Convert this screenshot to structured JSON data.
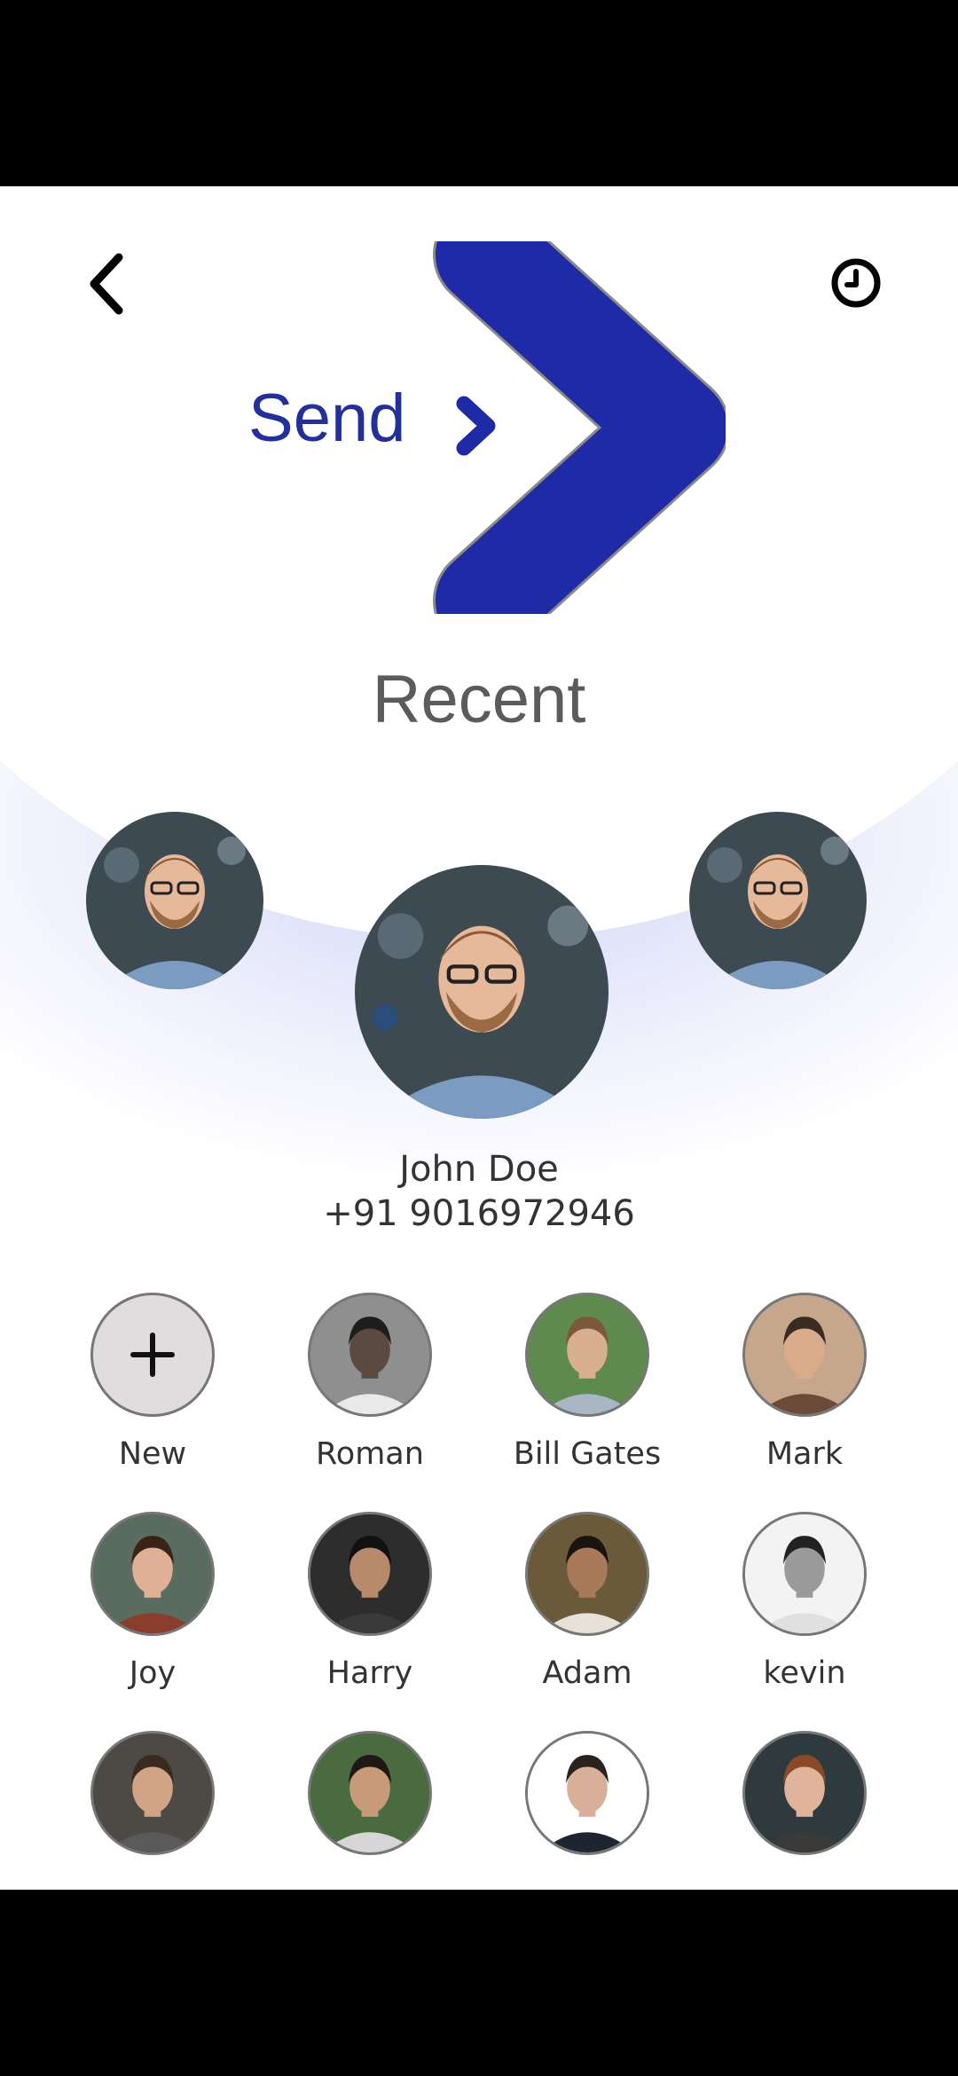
{
  "header": {
    "brand_word": "Send"
  },
  "recent": {
    "title": "Recent",
    "selected_contact": {
      "name": "John Doe",
      "phone": "+91 9016972946"
    }
  },
  "contacts": [
    {
      "label": "New",
      "icon": "plus-icon"
    },
    {
      "label": "Roman",
      "bg": "#8f8f8f",
      "skin": "#5b4a41",
      "hair": "#1d1d1d",
      "shirt": "#e9e9e9"
    },
    {
      "label": "Bill Gates",
      "bg": "#5f8a4f",
      "skin": "#d9b08f",
      "hair": "#7a5a3a",
      "shirt": "#a9b6c4"
    },
    {
      "label": "Mark",
      "bg": "#c7a78c",
      "skin": "#d9ab8b",
      "hair": "#3a2a22",
      "shirt": "#6b4a3a"
    },
    {
      "label": "Joy",
      "bg": "#5a6b5f",
      "skin": "#e0b096",
      "hair": "#3a2418",
      "shirt": "#8a3d2c"
    },
    {
      "label": "Harry",
      "bg": "#2d2d2d",
      "skin": "#b88a6c",
      "hair": "#111111",
      "shirt": "#3a3a3a"
    },
    {
      "label": "Adam",
      "bg": "#6b5a3a",
      "skin": "#a87a5a",
      "hair": "#1a1410",
      "shirt": "#e8e1d8"
    },
    {
      "label": "kevin",
      "bg": "#f3f3f3",
      "skin": "#9a9a9a",
      "hair": "#222222",
      "shirt": "#e0e0e0"
    },
    {
      "label": "",
      "bg": "#4d4a45",
      "skin": "#d2a487",
      "hair": "#3a2a20",
      "shirt": "#5a5a5a"
    },
    {
      "label": "",
      "bg": "#4a6a40",
      "skin": "#c99a78",
      "hair": "#1e1914",
      "shirt": "#d6d6d6"
    },
    {
      "label": "",
      "bg": "#ffffff",
      "skin": "#d8b09a",
      "hair": "#2a221c",
      "shirt": "#1e2530"
    },
    {
      "label": "",
      "bg": "#2e3a3e",
      "skin": "#e0b49a",
      "hair": "#8a4a2a",
      "shirt": "#3a3a3a"
    }
  ],
  "colors": {
    "brand": "#24309a",
    "arrow": "#1e2aa6"
  },
  "icons": {
    "back": "chevron-left-icon",
    "history": "clock-icon"
  }
}
